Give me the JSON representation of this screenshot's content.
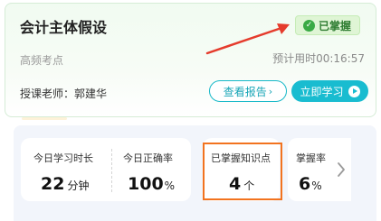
{
  "card": {
    "title": "会计主体假设",
    "badge": "已掌握",
    "tag": "高频考点",
    "estimated_time": "预计用时00:16:57",
    "teacher": "授课老师：郭建华",
    "report_button": "查看报告",
    "report_arrow": "›",
    "study_button": "立即学习"
  },
  "stats": {
    "study_time": {
      "label": "今日学习时长",
      "value": "22",
      "unit": "分钟"
    },
    "accuracy": {
      "label": "今日正确率",
      "value": "100",
      "unit": "%"
    },
    "mastered": {
      "label": "已掌握知识点",
      "value": "4",
      "unit": "个"
    },
    "mastery_rate": {
      "label": "掌握率",
      "value": "6",
      "unit": "%"
    }
  },
  "colors": {
    "accent": "#19bcd0",
    "badge_green": "#3aaa45",
    "highlight": "#f2731f",
    "annotation_arrow": "#e53b2c"
  }
}
